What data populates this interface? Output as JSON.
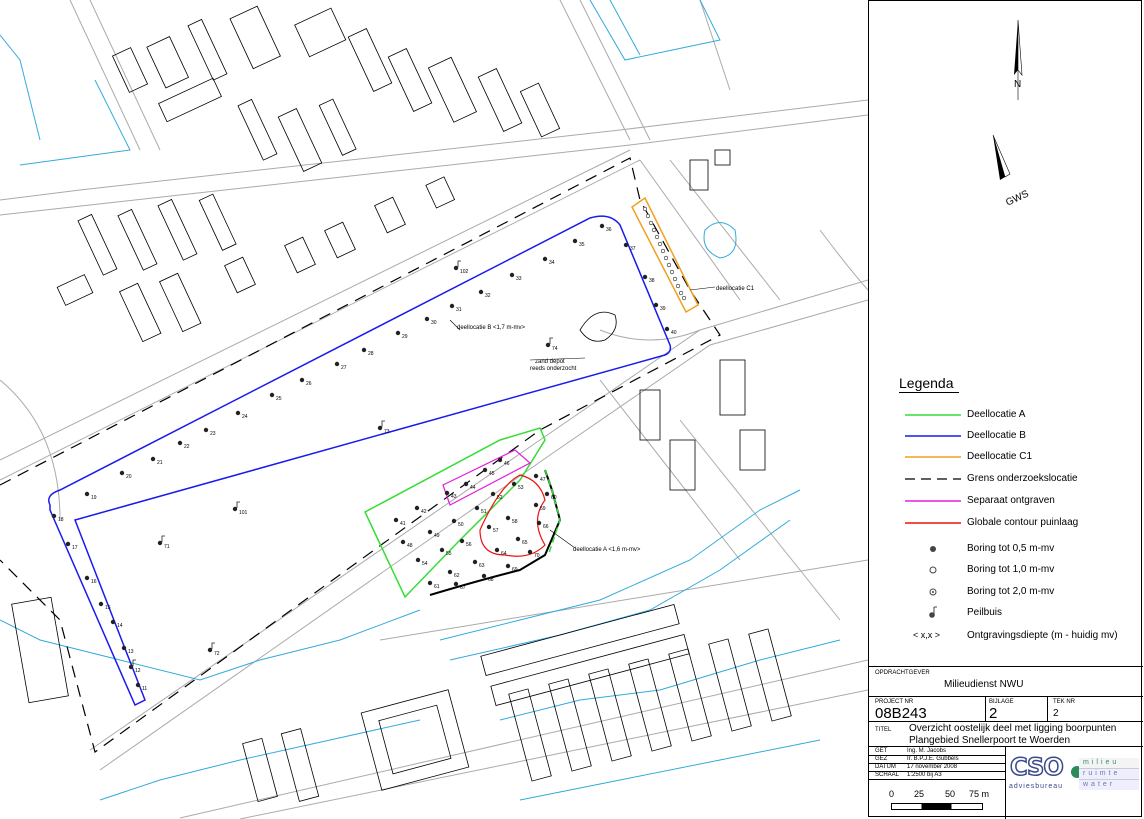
{
  "map": {
    "labels": {
      "deellocatie_b": "deellocatie B <1,7 m-mv>",
      "deellocatie_a": "deellocatie A <1,6 m-mv>",
      "deellocatie_c1": "deellocatie C1",
      "zand_depot_1": "zand depot",
      "zand_depot_2": "reeds onderzocht"
    },
    "points": [
      "11",
      "12",
      "13",
      "14",
      "15",
      "16",
      "17",
      "18",
      "19",
      "20",
      "21",
      "22",
      "23",
      "24",
      "25",
      "26",
      "27",
      "28",
      "29",
      "30",
      "31",
      "32",
      "33",
      "34",
      "35",
      "36",
      "37",
      "38",
      "39",
      "40",
      "41",
      "42",
      "43",
      "44",
      "45",
      "46",
      "47",
      "48",
      "49",
      "50",
      "51",
      "52",
      "53",
      "54",
      "55",
      "56",
      "57",
      "58",
      "59",
      "60",
      "61",
      "62",
      "63",
      "64",
      "65",
      "66",
      "67",
      "68",
      "69",
      "70",
      "71",
      "72",
      "73",
      "74",
      "101",
      "102"
    ],
    "north": "N",
    "gws": "GWS"
  },
  "legend": {
    "title": "Legenda",
    "items": [
      {
        "label": "Deellocatie A",
        "color": "#33dd33",
        "kind": "line"
      },
      {
        "label": "Deellocatie B",
        "color": "#1a1aee",
        "kind": "line"
      },
      {
        "label": "Deellocatie C1",
        "color": "#f0a020",
        "kind": "line"
      },
      {
        "label": "Grens onderzoekslocatie",
        "color": "#000000",
        "kind": "dash"
      },
      {
        "label": "Separaat ontgraven",
        "color": "#e020e0",
        "kind": "line"
      },
      {
        "label": "Globale contour puinlaag",
        "color": "#ee1111",
        "kind": "line"
      },
      {
        "label": "Boring tot 0,5 m-mv",
        "color": "#333333",
        "kind": "dot-filled"
      },
      {
        "label": "Boring tot 1,0 m-mv",
        "color": "#333333",
        "kind": "dot-open"
      },
      {
        "label": "Boring tot 2,0 m-mv",
        "color": "#333333",
        "kind": "dot-center"
      },
      {
        "label": "Peilbuis",
        "color": "#333333",
        "kind": "peilbuis"
      },
      {
        "label": "Ontgravingsdiepte (m - huidig mv)",
        "color": "#333333",
        "kind": "text",
        "symbol": "< x,x >"
      }
    ]
  },
  "titleblock": {
    "opdrachtgever_label": "OPDRACHTGEVER",
    "opdrachtgever": "Milieudienst NWU",
    "projectnr_label": "PROJECT NR",
    "projectnr": "08B243",
    "bijlage_label": "BIJLAGE",
    "bijlage": "2",
    "teknr_label": "TEK NR",
    "teknr": "2",
    "titel_label": "TITEL",
    "titel_1": "Overzicht oostelijk deel met ligging boorpunten",
    "titel_2": "Plangebied Snellerpoort te Woerden",
    "get_label": "GET",
    "get": "Ing. M. Jacobs",
    "gez_label": "GEZ",
    "gez": "Ir. B.P.J.E. Gubbels",
    "datum_label": "DATUM",
    "datum": "17 november 2008",
    "schaal_label": "SCHAAL",
    "schaal": "1:2500 bij A3",
    "scale_ticks": [
      "0",
      "25",
      "50",
      "75 m"
    ],
    "logo_text": "CSO",
    "logo_sub": "adviesbureau",
    "logo_words": [
      "milieu",
      "ruimte",
      "water"
    ]
  },
  "colors": {
    "water": "#33aadd",
    "road": "#999999",
    "building": "#000000"
  }
}
